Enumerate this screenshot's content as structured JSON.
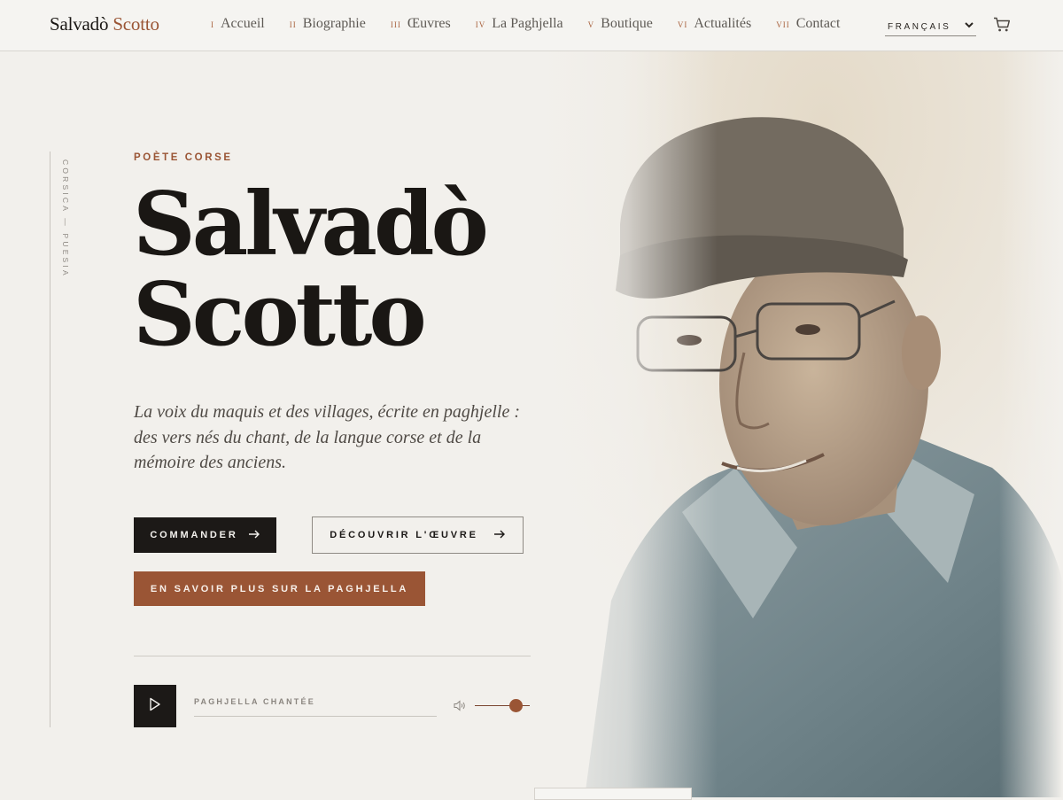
{
  "header": {
    "brand_first": "Salvadò",
    "brand_last": "Scotto",
    "nav": [
      {
        "num": "I",
        "label": "Accueil"
      },
      {
        "num": "II",
        "label": "Biographie"
      },
      {
        "num": "III",
        "label": "Œuvres"
      },
      {
        "num": "IV",
        "label": "La Paghjella"
      },
      {
        "num": "V",
        "label": "Boutique"
      },
      {
        "num": "VI",
        "label": "Actualités"
      },
      {
        "num": "VII",
        "label": "Contact"
      }
    ],
    "language": "FRANÇAIS",
    "cart_icon": "cart-icon",
    "colors": {
      "accent": "#9a5535",
      "dark": "#1c1917",
      "background": "#f2f0ec"
    }
  },
  "side_rail": {
    "text": "CORSICA — PUESIA"
  },
  "hero": {
    "eyebrow": "POÈTE CORSE",
    "title_line1": "Salvadò",
    "title_line2": "Scotto",
    "tagline": "La voix du maquis et des villages, écrite en paghjelle : des vers nés du chant, de la langue corse et de la mémoire des anciens.",
    "buttons": {
      "order": "COMMANDER",
      "discover": "DÉCOUVRIR L'ŒUVRE",
      "learn_more": "EN SAVOIR PLUS SUR LA PAGHJELLA"
    }
  },
  "player": {
    "track_label": "PAGHJELLA CHANTÉE",
    "volume": 0.75,
    "play_icon": "play-icon",
    "volume_icon": "volume-icon"
  }
}
